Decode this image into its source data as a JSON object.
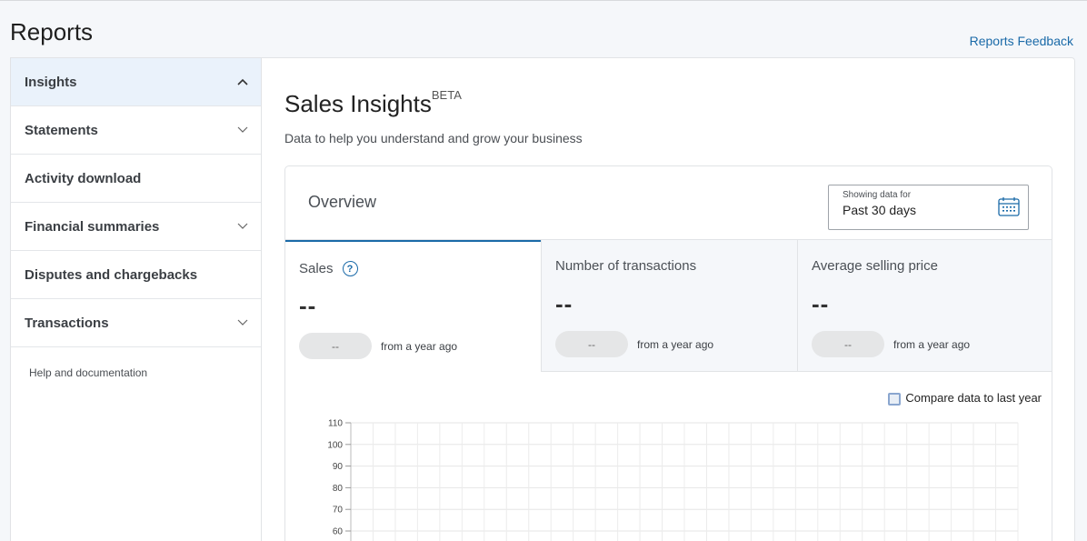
{
  "header": {
    "title": "Reports",
    "feedback_link": "Reports Feedback"
  },
  "sidebar": {
    "items": [
      {
        "label": "Insights",
        "expanded": true
      },
      {
        "label": "Statements",
        "expanded": false
      },
      {
        "label": "Activity download"
      },
      {
        "label": "Financial summaries",
        "expanded": false
      },
      {
        "label": "Disputes and chargebacks"
      },
      {
        "label": "Transactions",
        "expanded": false
      }
    ],
    "help": "Help and documentation"
  },
  "main": {
    "title": "Sales Insights",
    "title_badge": "BETA",
    "subtitle": "Data to help you understand and grow your business",
    "overview": {
      "title": "Overview",
      "date_label": "Showing data for",
      "date_value": "Past 30 days"
    },
    "metrics": [
      {
        "label": "Sales",
        "value": "--",
        "change": "--",
        "change_text": "from a year ago"
      },
      {
        "label": "Number of transactions",
        "value": "--",
        "change": "--",
        "change_text": "from a year ago"
      },
      {
        "label": "Average selling price",
        "value": "--",
        "change": "--",
        "change_text": "from a year ago"
      }
    ],
    "compare_label": "Compare data to last year",
    "compare_checked": false
  },
  "colors": {
    "accent": "#1a6aa8",
    "active_sidebar_bg": "#eaf2fb"
  },
  "chart_data": {
    "type": "line",
    "title": "",
    "xlabel": "",
    "ylabel": "",
    "y_ticks": [
      110,
      100,
      90,
      80,
      70,
      60
    ],
    "series": [],
    "grid": true
  }
}
